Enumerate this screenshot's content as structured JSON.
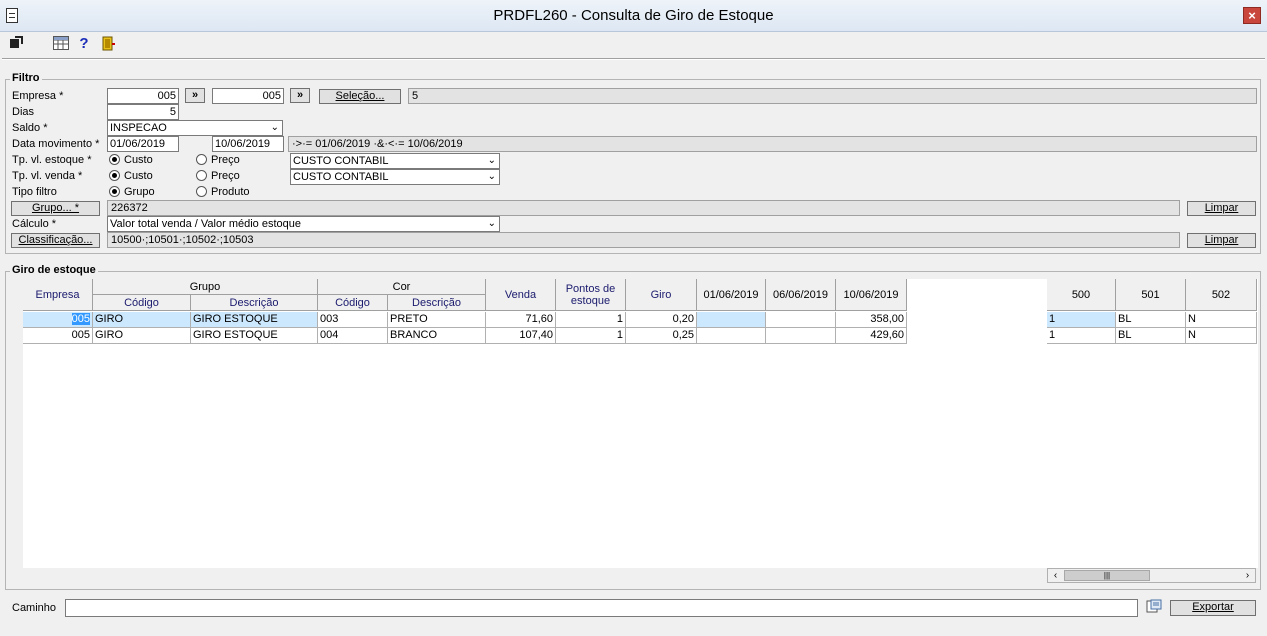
{
  "window": {
    "title": "PRDFL260 - Consulta de Giro de Estoque",
    "close": "×"
  },
  "filtro": {
    "title": "Filtro",
    "empresa_label": "Empresa *",
    "empresa_from": "005",
    "empresa_to": "005",
    "arrow": "»",
    "selecao_button": "Seleção...",
    "selecao_value": "5",
    "dias_label": "Dias",
    "dias_value": "5",
    "saldo_label": "Saldo *",
    "saldo_value": "INSPECAO",
    "data_label": "Data movimento *",
    "data_from": "01/06/2019",
    "data_to": "10/06/2019",
    "data_expr": "·>·= 01/06/2019 ·&·<·= 10/06/2019",
    "tp_estoque_label": "Tp. vl. estoque *",
    "tp_venda_label": "Tp. vl. venda *",
    "custo": "Custo",
    "preco": "Preço",
    "custo_contabil_1": "CUSTO CONTABIL",
    "custo_contabil_2": "CUSTO CONTABIL",
    "tipo_filtro_label": "Tipo filtro",
    "grupo": "Grupo",
    "produto": "Produto",
    "grupo_button": "Grupo... *",
    "grupo_value": "226372",
    "limpar": "Limpar",
    "calculo_label": "Cálculo *",
    "calculo_value": "Valor total venda / Valor médio estoque",
    "classificacao_button": "Classificação...",
    "classificacao_value": "10500·;10501·;10502·;10503"
  },
  "giro": {
    "title": "Giro de estoque",
    "headers": {
      "empresa": "Empresa",
      "grupo": "Grupo",
      "cor": "Cor",
      "codigo": "Código",
      "descricao": "Descrição",
      "venda": "Venda",
      "pontos": "Pontos de estoque",
      "giro": "Giro",
      "d1": "01/06/2019",
      "d2": "06/06/2019",
      "d3": "10/06/2019",
      "c500": "500",
      "c501": "501",
      "c502": "502"
    },
    "rows": [
      {
        "empresa": "005",
        "grupo_cod": "GIRO",
        "grupo_desc": "GIRO ESTOQUE",
        "cor_cod": "003",
        "cor_desc": "PRETO",
        "venda": "71,60",
        "pontos": "1",
        "giro": "0,20",
        "d1": "",
        "d2": "",
        "d3": "358,00",
        "c500": "1",
        "c501": "BL",
        "c502": "N"
      },
      {
        "empresa": "005",
        "grupo_cod": "GIRO",
        "grupo_desc": "GIRO ESTOQUE",
        "cor_cod": "004",
        "cor_desc": "BRANCO",
        "venda": "107,40",
        "pontos": "1",
        "giro": "0,25",
        "d1": "",
        "d2": "",
        "d3": "429,60",
        "c500": "1",
        "c501": "BL",
        "c502": "N"
      }
    ]
  },
  "bottom": {
    "caminho_label": "Caminho",
    "caminho_value": "",
    "exportar": "Exportar"
  },
  "icons": {
    "scroll_left": "‹",
    "scroll_right": "›",
    "thumb": "|||",
    "help": "?"
  }
}
